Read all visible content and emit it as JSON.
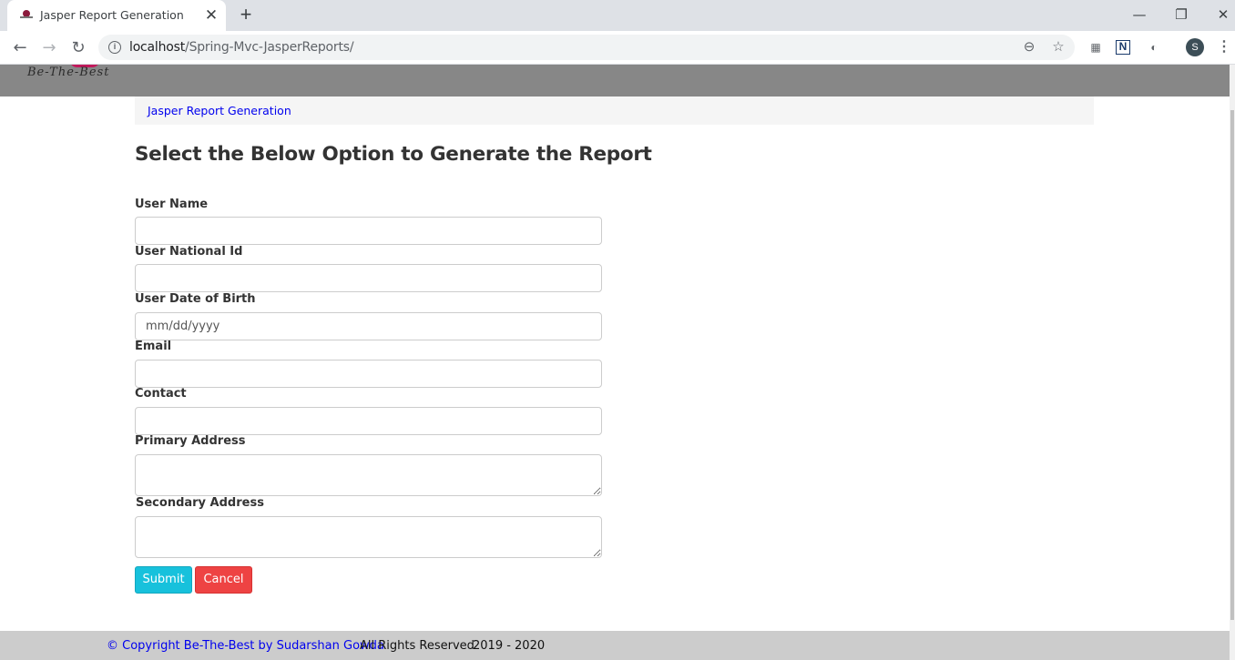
{
  "browser": {
    "tab_title": "Jasper Report Generation",
    "tab_close_glyph": "✕",
    "new_tab_glyph": "+",
    "url_host": "localhost",
    "url_path": "/Spring-Mvc-JasperReports/",
    "profile_initial": "S",
    "window_controls": {
      "minimize": "—",
      "maximize": "❐",
      "close": "✕"
    },
    "icons": [
      "back-icon",
      "forward-icon",
      "reload-icon",
      "info-icon",
      "zoom-icon",
      "star-icon",
      "extension-icon",
      "notion-icon",
      "dark-mode-icon",
      "menu-icon"
    ]
  },
  "site": {
    "logo_text": "Be-The-Best",
    "logo_color": "#c2185b",
    "header_color": "#878787"
  },
  "breadcrumb": {
    "label": "Jasper Report Generation"
  },
  "page": {
    "title": "Select the Below Option to Generate the Report"
  },
  "form": {
    "user_name": {
      "label": "User Name",
      "value": ""
    },
    "national_id": {
      "label": "User National Id",
      "value": ""
    },
    "dob": {
      "label": "User Date of Birth",
      "placeholder": "mm/dd/yyyy"
    },
    "email": {
      "label": "Email",
      "value": ""
    },
    "contact": {
      "label": "Contact",
      "value": ""
    },
    "primary_address": {
      "label": "Primary Address",
      "value": ""
    },
    "secondary_address": {
      "label": "Secondary Address",
      "value": ""
    },
    "submit_label": "Submit",
    "cancel_label": "Cancel",
    "submit_color": "#17c1dc",
    "cancel_color": "#ee4343"
  },
  "footer": {
    "copyright": "© Copyright Be-The-Best by Sudarshan Gowda",
    "rights": "All Rights Reserved",
    "years": "2019 - 2020"
  }
}
